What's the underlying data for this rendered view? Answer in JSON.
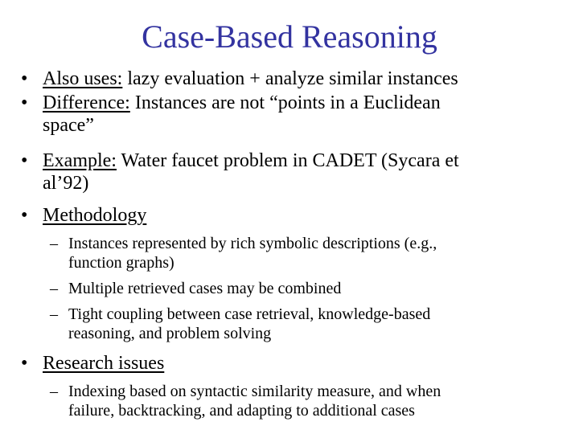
{
  "slide": {
    "title": "Case-Based Reasoning",
    "title_color": "#3333a0",
    "bullet_glyph": "•",
    "dash_glyph": "–",
    "items": [
      {
        "label": "Also uses:",
        "lines": [
          " lazy evaluation + analyze similar instances"
        ]
      },
      {
        "label": "Difference:",
        "lines": [
          " Instances are not “points in a Euclidean",
          "space”"
        ]
      },
      {
        "label": "Example:",
        "lines": [
          " Water faucet problem in CADET (Sycara et",
          "al’92)"
        ]
      },
      {
        "label": "Methodology",
        "lines": [
          ""
        ]
      },
      {
        "label": "Research issues",
        "lines": [
          ""
        ]
      }
    ],
    "methodology_sub": [
      {
        "lines": [
          "Instances represented by rich symbolic descriptions (e.g.,",
          "function graphs)"
        ]
      },
      {
        "lines": [
          "Multiple retrieved cases may be combined"
        ]
      },
      {
        "lines": [
          "Tight coupling between case retrieval, knowledge-based",
          "reasoning, and problem solving"
        ]
      }
    ],
    "research_sub": [
      {
        "lines": [
          "Indexing based on syntactic similarity measure,  and when",
          "failure, backtracking, and adapting to additional cases"
        ]
      }
    ]
  }
}
